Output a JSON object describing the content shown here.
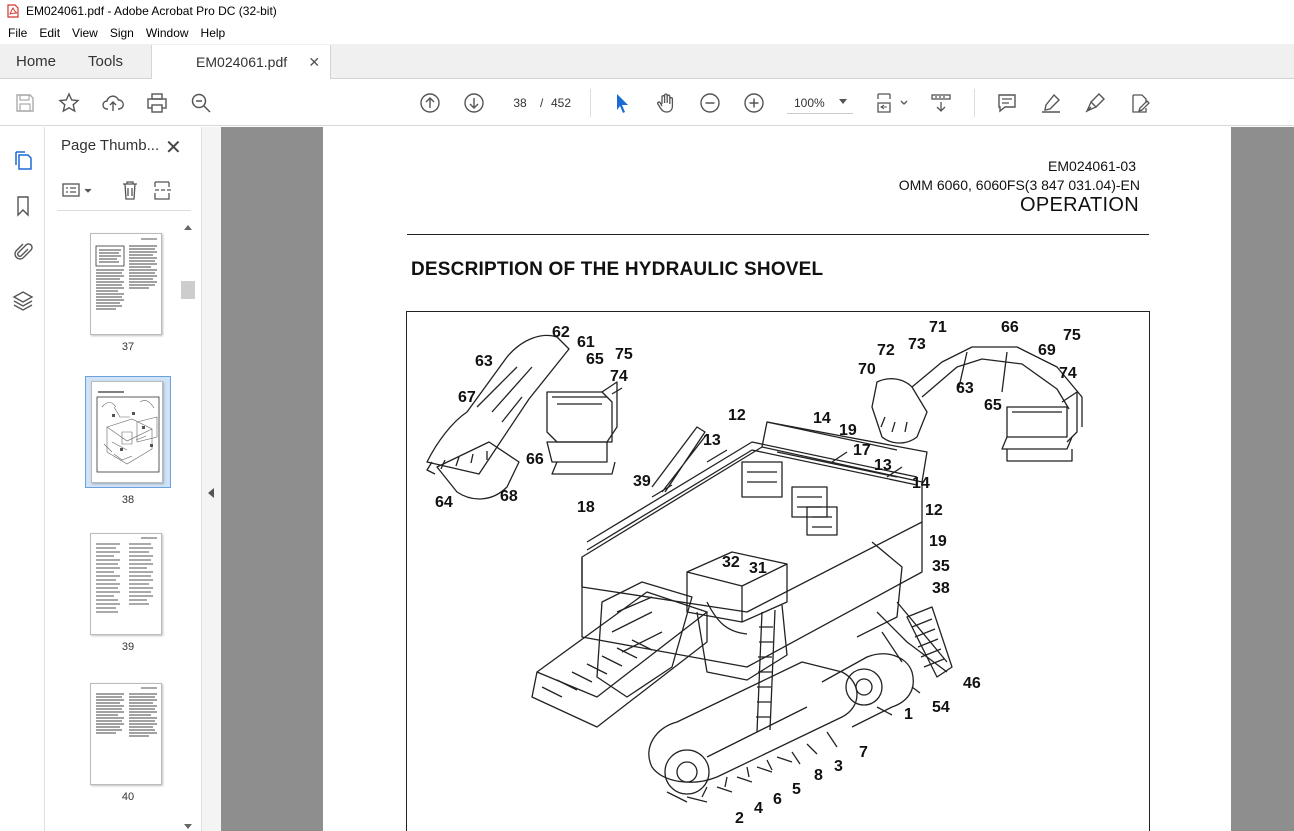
{
  "window": {
    "title": "EM024061.pdf - Adobe Acrobat Pro DC (32-bit)"
  },
  "menu": [
    "File",
    "Edit",
    "View",
    "Sign",
    "Window",
    "Help"
  ],
  "tabs": {
    "home": "Home",
    "tools": "Tools",
    "document": "EM024061.pdf"
  },
  "toolbar": {
    "current_page": "38",
    "separator": "/",
    "total_pages": "452",
    "zoom": "100%",
    "icons": [
      "save-icon",
      "star-icon",
      "upload-icon",
      "print-icon",
      "zoom-search-icon",
      "page-up-icon",
      "page-down-icon",
      "select-cursor-icon",
      "hand-icon",
      "zoom-out-icon",
      "zoom-in-icon",
      "page-fit-icon",
      "scroll-mode-icon",
      "comment-icon",
      "highlight-icon",
      "sign-icon",
      "edit-pdf-icon"
    ]
  },
  "thumbnails": {
    "panel_title": "Page Thumb...",
    "pages": [
      {
        "number": "37",
        "selected": false
      },
      {
        "number": "38",
        "selected": true
      },
      {
        "number": "39",
        "selected": false
      },
      {
        "number": "40",
        "selected": false
      }
    ]
  },
  "document": {
    "code": "EM024061-03",
    "model": "OMM 6060, 6060FS(3 847 031.04)-EN",
    "section": "OPERATION",
    "heading": "DESCRIPTION OF THE HYDRAULIC SHOVEL",
    "callouts": [
      "62",
      "61",
      "63",
      "65",
      "75",
      "74",
      "67",
      "66",
      "64",
      "68",
      "71",
      "66",
      "72",
      "73",
      "75",
      "70",
      "69",
      "74",
      "63",
      "65",
      "12",
      "14",
      "19",
      "13",
      "17",
      "13",
      "14",
      "39",
      "12",
      "18",
      "19",
      "32",
      "31",
      "35",
      "38",
      "46",
      "1",
      "54",
      "7",
      "3",
      "8",
      "5",
      "6",
      "4",
      "2"
    ]
  }
}
